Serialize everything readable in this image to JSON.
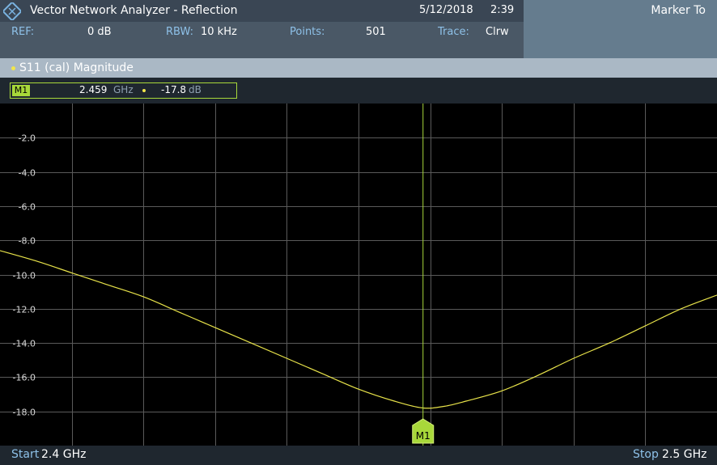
{
  "title": "Vector Network Analyzer - Reflection",
  "date": "5/12/2018",
  "time": "2:39",
  "marker_to_label": "Marker To",
  "params": {
    "ref_label": "REF:",
    "ref_value": "0 dB",
    "rbw_label": "RBW:",
    "rbw_value": "10 kHz",
    "points_label": "Points:",
    "points_value": "501",
    "trace_label": "Trace:",
    "trace_value": "Clrw"
  },
  "trace_title": "S11 (cal) Magnitude",
  "marker": {
    "name": "M1",
    "freq": "2.459",
    "freq_unit": "GHz",
    "value": "-17.8",
    "value_unit": "dB",
    "label": "M1"
  },
  "footer": {
    "start_label": "Start",
    "start_value": "2.4 GHz",
    "stop_label": "Stop",
    "stop_value": "2.5 GHz"
  },
  "colors": {
    "trace": "#e8e34a",
    "marker": "#a8d83a",
    "grid": "#5a5a5a"
  },
  "chart_data": {
    "type": "line",
    "xlim": [
      2.4,
      2.5
    ],
    "ylim": [
      -20,
      0
    ],
    "y_ticks": [
      "-2.0",
      "-4.0",
      "-6.0",
      "-8.0",
      "-10.0",
      "-12.0",
      "-14.0",
      "-16.0",
      "-18.0"
    ],
    "grid": true,
    "x": [
      2.4,
      2.405,
      2.41,
      2.415,
      2.42,
      2.425,
      2.43,
      2.435,
      2.44,
      2.445,
      2.45,
      2.455,
      2.459,
      2.462,
      2.465,
      2.47,
      2.475,
      2.48,
      2.485,
      2.49,
      2.495,
      2.5
    ],
    "y": [
      -8.6,
      -9.2,
      -9.9,
      -10.6,
      -11.3,
      -12.2,
      -13.1,
      -14.0,
      -14.9,
      -15.8,
      -16.7,
      -17.4,
      -17.8,
      -17.7,
      -17.4,
      -16.8,
      -15.9,
      -14.9,
      -14.0,
      -13.0,
      -12.0,
      -11.2
    ]
  }
}
